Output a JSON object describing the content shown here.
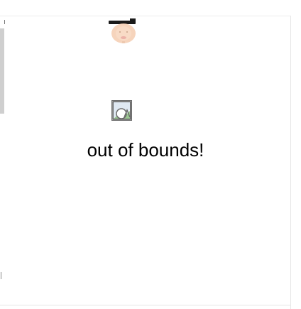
{
  "page": {
    "message": "out of bounds!"
  },
  "sprite": {
    "icon": "character-face-icon",
    "colors": {
      "hat": "#1a1a1a",
      "skin": "#f2c8a8",
      "shade": "#e8a7a0"
    }
  },
  "broken_image": {
    "icon": "broken-image-icon",
    "colors": {
      "frame": "#6b6b6b",
      "sky": "#9bb8d8",
      "ground": "#4a9a3a"
    }
  }
}
